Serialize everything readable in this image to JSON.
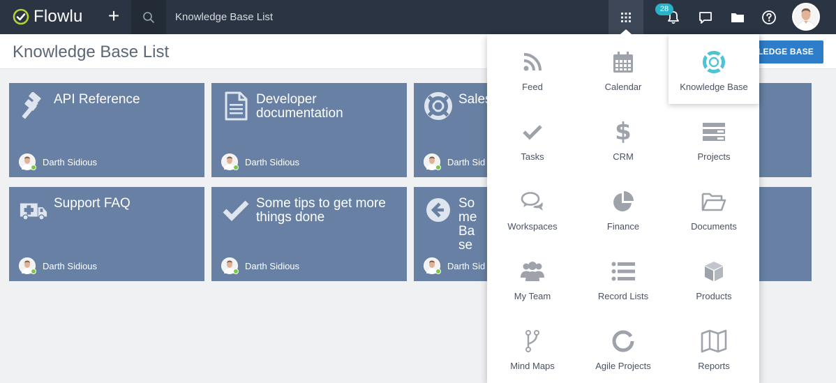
{
  "topbar": {
    "logo_text": "Flowlu",
    "breadcrumb": "Knowledge Base List",
    "notification_count": "28",
    "icons": [
      "add-icon",
      "search-icon",
      "apps-grid-icon",
      "bell-icon",
      "chat-icon",
      "folder-icon",
      "help-icon"
    ]
  },
  "page": {
    "title": "Knowledge Base List",
    "button_label": "WLEDGE BASE"
  },
  "cards": [
    {
      "title": "API Reference",
      "author": "Darth Sidious",
      "icon": "gavel-icon"
    },
    {
      "title": "Developer documentation",
      "author": "Darth Sidious",
      "icon": "document-icon"
    },
    {
      "title": "Sales",
      "author": "Darth Sid",
      "icon": "lifebuoy-icon"
    },
    {
      "title": "Support FAQ",
      "author": "Darth Sidious",
      "icon": "ambulance-icon"
    },
    {
      "title": "Some tips to get more things done",
      "author": "Darth Sidious",
      "icon": "check-icon"
    },
    {
      "title": "Some Base",
      "author": "Darth Sid",
      "icon": "arrow-left-icon"
    }
  ],
  "apps": [
    {
      "label": "Feed",
      "icon": "rss-icon"
    },
    {
      "label": "Calendar",
      "icon": "calendar-icon"
    },
    {
      "label": "Knowledge Base",
      "icon": "lifebuoy-icon",
      "active": true
    },
    {
      "label": "Tasks",
      "icon": "check-icon"
    },
    {
      "label": "CRM",
      "icon": "dollar-icon"
    },
    {
      "label": "Projects",
      "icon": "projects-icon"
    },
    {
      "label": "Workspaces",
      "icon": "chat-bubbles-icon"
    },
    {
      "label": "Finance",
      "icon": "pie-chart-icon"
    },
    {
      "label": "Documents",
      "icon": "folder-open-icon"
    },
    {
      "label": "My Team",
      "icon": "team-icon"
    },
    {
      "label": "Record Lists",
      "icon": "list-icon"
    },
    {
      "label": "Products",
      "icon": "cube-icon"
    },
    {
      "label": "Mind Maps",
      "icon": "branch-icon"
    },
    {
      "label": "Agile Projects",
      "icon": "ring-icon"
    },
    {
      "label": "Reports",
      "icon": "map-icon"
    }
  ],
  "colors": {
    "topbar": "#2b3442",
    "card": "#6780a3",
    "accent_blue": "#2d7dc9",
    "badge_teal": "#28b4c8",
    "kb_icon_teal": "#4ec3d3",
    "app_icon_gray": "#9ea3ab"
  }
}
